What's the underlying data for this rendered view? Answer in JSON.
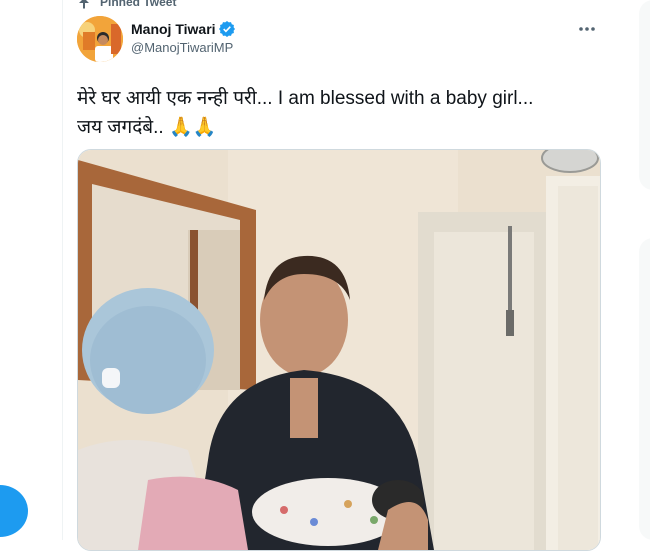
{
  "tweet": {
    "pinned_label": "Pinned Tweet",
    "author_name": "Manoj Tiwari",
    "author_handle": "@ManojTiwariMP",
    "text_line1": "मेरे घर आयी एक नन्ही परी...  I am blessed with a baby girl...",
    "text_line2": "जय जगदंबे.. 🙏🙏"
  },
  "icons": {
    "pin": "pin-icon",
    "verified": "verified-badge-icon",
    "more": "more-horizontal-icon",
    "compose": "compose-tweet-button"
  },
  "colors": {
    "accent": "#1d9bf0",
    "text_primary": "#0f1419",
    "text_secondary": "#536471",
    "border": "#cfd9de"
  }
}
